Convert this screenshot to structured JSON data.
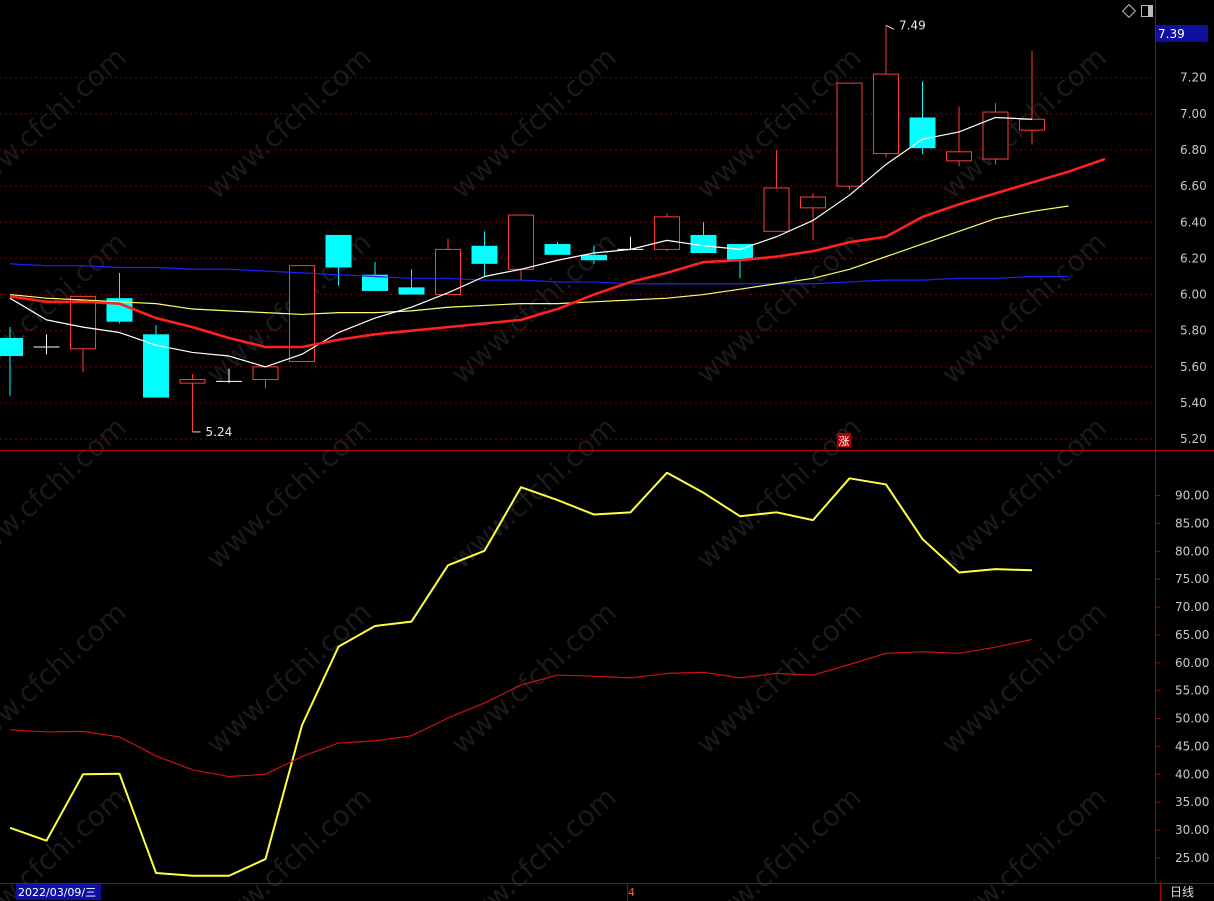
{
  "watermark": "www.cfchi.com",
  "toolbar": {
    "diamond_icon": "diamond-icon",
    "panel_icon": "panel-toggle-icon"
  },
  "status": {
    "date": "2022/03/09/三",
    "month_marker": "4",
    "period": "日线",
    "rise_marker": "涨"
  },
  "chart_data": [
    {
      "type": "candlestick",
      "price_badge": "7.39",
      "ylim": [
        5.14,
        7.63
      ],
      "yticks": [
        5.2,
        5.4,
        5.6,
        5.8,
        6.0,
        6.2,
        6.4,
        6.6,
        6.8,
        7.0,
        7.2
      ],
      "ytick_labels": [
        "5.20",
        "5.40",
        "5.60",
        "5.80",
        "6.00",
        "6.20",
        "6.40",
        "6.60",
        "6.80",
        "7.00",
        "7.20"
      ],
      "annotations": [
        {
          "text": "7.49",
          "value": 7.49,
          "index": 24
        },
        {
          "text": "5.24",
          "value": 5.24,
          "index": 5
        }
      ],
      "colors": {
        "up": "#ff3b3b",
        "down": "#00ffff",
        "flat": "#ffffff",
        "ma5": "#ffffff",
        "ma10": "#ff2020",
        "ma20": "#ffff66",
        "ma60": "#2020ff",
        "grid": "#8b0000"
      },
      "candles": [
        {
          "o": 5.76,
          "h": 5.82,
          "l": 5.44,
          "c": 5.66
        },
        {
          "o": 5.71,
          "h": 5.78,
          "l": 5.67,
          "c": 5.71
        },
        {
          "o": 5.7,
          "h": 5.99,
          "l": 5.57,
          "c": 5.99
        },
        {
          "o": 5.98,
          "h": 6.12,
          "l": 5.84,
          "c": 5.85
        },
        {
          "o": 5.78,
          "h": 5.83,
          "l": 5.43,
          "c": 5.43
        },
        {
          "o": 5.51,
          "h": 5.56,
          "l": 5.24,
          "c": 5.53
        },
        {
          "o": 5.52,
          "h": 5.59,
          "l": 5.51,
          "c": 5.52
        },
        {
          "o": 5.53,
          "h": 5.6,
          "l": 5.48,
          "c": 5.6
        },
        {
          "o": 5.63,
          "h": 6.16,
          "l": 5.63,
          "c": 6.16
        },
        {
          "o": 6.33,
          "h": 6.33,
          "l": 6.05,
          "c": 6.15
        },
        {
          "o": 6.11,
          "h": 6.18,
          "l": 6.02,
          "c": 6.02
        },
        {
          "o": 6.04,
          "h": 6.14,
          "l": 6.0,
          "c": 6.0
        },
        {
          "o": 6.0,
          "h": 6.31,
          "l": 6.0,
          "c": 6.25
        },
        {
          "o": 6.27,
          "h": 6.35,
          "l": 6.1,
          "c": 6.17
        },
        {
          "o": 6.14,
          "h": 6.44,
          "l": 6.08,
          "c": 6.44
        },
        {
          "o": 6.28,
          "h": 6.29,
          "l": 6.22,
          "c": 6.22
        },
        {
          "o": 6.22,
          "h": 6.27,
          "l": 6.17,
          "c": 6.19
        },
        {
          "o": 6.25,
          "h": 6.32,
          "l": 6.25,
          "c": 6.25
        },
        {
          "o": 6.25,
          "h": 6.45,
          "l": 6.24,
          "c": 6.43
        },
        {
          "o": 6.33,
          "h": 6.4,
          "l": 6.23,
          "c": 6.23
        },
        {
          "o": 6.28,
          "h": 6.28,
          "l": 6.09,
          "c": 6.19
        },
        {
          "o": 6.35,
          "h": 6.8,
          "l": 6.35,
          "c": 6.59
        },
        {
          "o": 6.48,
          "h": 6.56,
          "l": 6.3,
          "c": 6.54
        },
        {
          "o": 6.6,
          "h": 7.17,
          "l": 6.58,
          "c": 7.17
        },
        {
          "o": 6.78,
          "h": 7.49,
          "l": 6.76,
          "c": 7.22
        },
        {
          "o": 6.98,
          "h": 7.18,
          "l": 6.78,
          "c": 6.81
        },
        {
          "o": 6.74,
          "h": 7.04,
          "l": 6.71,
          "c": 6.79
        },
        {
          "o": 6.75,
          "h": 7.06,
          "l": 6.72,
          "c": 7.01
        },
        {
          "o": 6.91,
          "h": 7.35,
          "l": 6.83,
          "c": 6.97
        }
      ],
      "ma5": [
        5.98,
        5.86,
        5.82,
        5.79,
        5.72,
        5.68,
        5.66,
        5.6,
        5.67,
        5.79,
        5.87,
        5.93,
        6.01,
        6.1,
        6.14,
        6.19,
        6.23,
        6.25,
        6.3,
        6.27,
        6.25,
        6.32,
        6.41,
        6.55,
        6.72,
        6.86,
        6.9,
        6.98,
        6.97
      ],
      "ma10": [
        5.99,
        5.96,
        5.96,
        5.95,
        5.87,
        5.82,
        5.76,
        5.71,
        5.71,
        5.75,
        5.78,
        5.8,
        5.82,
        5.84,
        5.86,
        5.92,
        6.0,
        6.07,
        6.12,
        6.18,
        6.19,
        6.21,
        6.24,
        6.29,
        6.32,
        6.43,
        6.5,
        6.56,
        6.62,
        6.68,
        6.75
      ],
      "ma20": [
        6.0,
        5.98,
        5.97,
        5.96,
        5.95,
        5.92,
        5.91,
        5.9,
        5.89,
        5.9,
        5.9,
        5.91,
        5.93,
        5.94,
        5.95,
        5.95,
        5.96,
        5.97,
        5.98,
        6.0,
        6.03,
        6.06,
        6.09,
        6.14,
        6.21,
        6.28,
        6.35,
        6.42,
        6.46,
        6.49
      ],
      "ma60": [
        6.17,
        6.16,
        6.16,
        6.15,
        6.15,
        6.14,
        6.14,
        6.13,
        6.12,
        6.11,
        6.1,
        6.09,
        6.09,
        6.08,
        6.08,
        6.07,
        6.07,
        6.06,
        6.06,
        6.06,
        6.06,
        6.06,
        6.06,
        6.07,
        6.08,
        6.08,
        6.09,
        6.09,
        6.1,
        6.1
      ]
    },
    {
      "type": "line",
      "ylim": [
        20.5,
        98
      ],
      "yticks": [
        25,
        30,
        35,
        40,
        45,
        50,
        55,
        60,
        65,
        70,
        75,
        80,
        85,
        90
      ],
      "ytick_labels": [
        "25.00",
        "30.00",
        "35.00",
        "40.00",
        "45.00",
        "50.00",
        "55.00",
        "60.00",
        "65.00",
        "70.00",
        "75.00",
        "80.00",
        "85.00",
        "90.00"
      ],
      "series": [
        {
          "color": "#ffff40",
          "values": [
            30.4,
            28.1,
            40.0,
            40.1,
            22.3,
            21.8,
            21.8,
            24.8,
            48.8,
            62.9,
            66.6,
            67.4,
            77.5,
            80.1,
            91.5,
            89.2,
            86.6,
            87.0,
            94.1,
            90.5,
            86.3,
            87.0,
            85.6,
            93.1,
            92.0,
            82.2,
            76.2,
            76.8,
            76.6
          ]
        },
        {
          "color": "#d01010",
          "values": [
            48.0,
            47.6,
            47.7,
            46.7,
            43.3,
            40.8,
            39.6,
            40.0,
            43.2,
            45.6,
            46.0,
            46.9,
            50.1,
            52.8,
            56.0,
            57.8,
            57.6,
            57.3,
            58.1,
            58.3,
            57.3,
            58.1,
            57.8,
            59.7,
            61.7,
            62.0,
            61.7,
            62.8,
            64.2
          ]
        }
      ]
    }
  ]
}
